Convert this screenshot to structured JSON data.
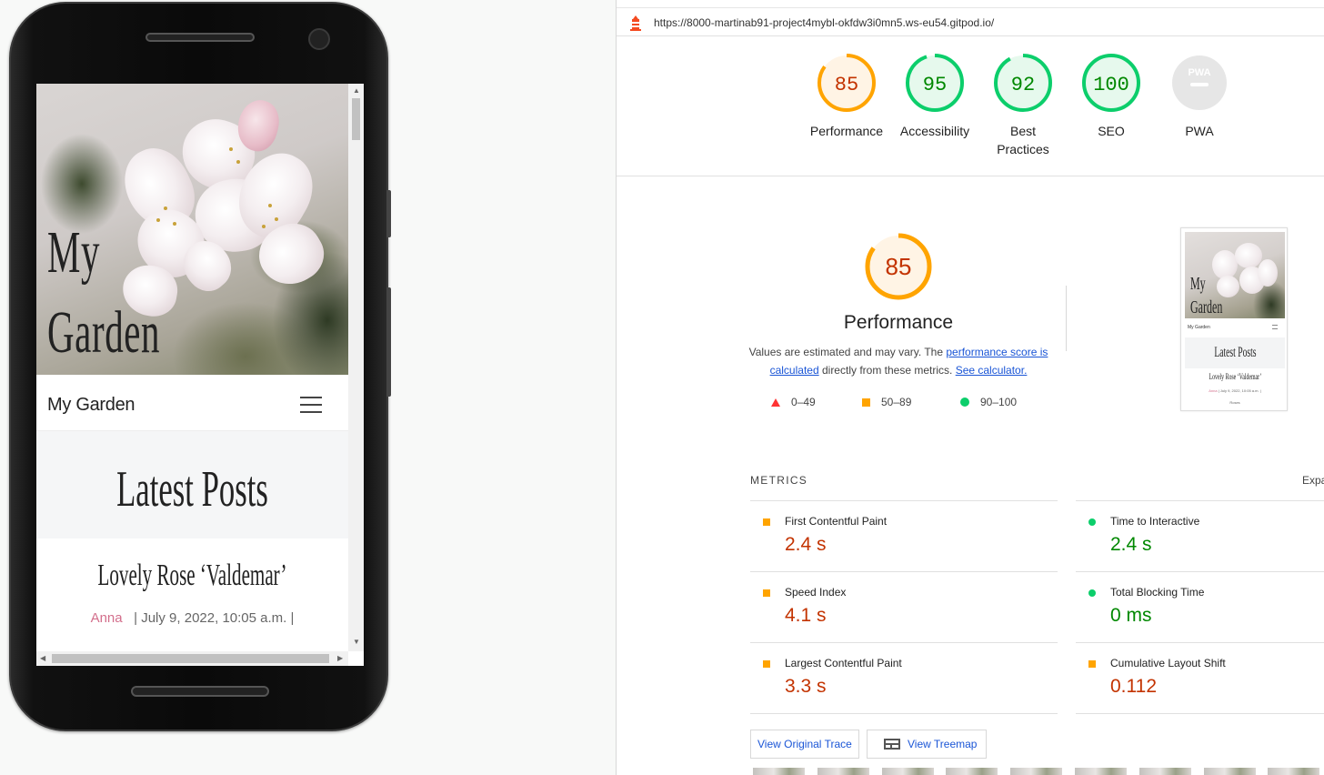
{
  "device": {
    "hero_title_line1": "My",
    "hero_title_line2": "Garden",
    "brand": "My Garden",
    "latest_posts": "Latest Posts",
    "post": {
      "title": "Lovely Rose ‘Valdemar’",
      "author": "Anna",
      "sep1": "|",
      "date": "July 9, 2022, 10:05 a.m.",
      "sep2": "|"
    }
  },
  "report": {
    "url": "https://8000-martinab91-project4mybl-okfdw3i0mn5.ws-eu54.gitpod.io/",
    "gauges": [
      {
        "label": "Performance",
        "score": "85",
        "status": "average"
      },
      {
        "label": "Accessibility",
        "score": "95",
        "status": "pass"
      },
      {
        "label": "Best Practices",
        "score": "92",
        "status": "pass"
      },
      {
        "label": "SEO",
        "score": "100",
        "status": "pass"
      },
      {
        "label": "PWA",
        "score": "PWA",
        "status": "na"
      }
    ],
    "performance": {
      "score": "85",
      "title": "Performance",
      "desc_text1": "Values are estimated and may vary. The ",
      "desc_link1": "performance score is calculated",
      "desc_text2": " directly from these metrics. ",
      "desc_link2": "See calculator."
    },
    "legend": [
      {
        "range": "0–49",
        "shape": "triangle",
        "color": "#ff3333"
      },
      {
        "range": "50–89",
        "shape": "square",
        "color": "#ffa400"
      },
      {
        "range": "90–100",
        "shape": "circle",
        "color": "#0cce6b"
      }
    ],
    "thumbnail": {
      "hero_line1": "My",
      "hero_line2": "Garden",
      "brand": "My Garden",
      "latest": "Latest Posts",
      "post_title": "Lovely Rose ‘Valdemar’",
      "author": "Anna",
      "meta": "| July 9, 2022, 10:05 a.m. |",
      "more": "Roses"
    },
    "metrics_heading": "METRICS",
    "expand_label": "Expa",
    "metrics": [
      {
        "name": "First Contentful Paint",
        "value": "2.4 s",
        "status": "average"
      },
      {
        "name": "Time to Interactive",
        "value": "2.4 s",
        "status": "pass"
      },
      {
        "name": "Speed Index",
        "value": "4.1 s",
        "status": "average"
      },
      {
        "name": "Total Blocking Time",
        "value": "0 ms",
        "status": "pass"
      },
      {
        "name": "Largest Contentful Paint",
        "value": "3.3 s",
        "status": "average"
      },
      {
        "name": "Cumulative Layout Shift",
        "value": "0.112",
        "status": "average"
      }
    ],
    "buttons": {
      "view_trace": "View Original Trace",
      "view_treemap": "View Treemap"
    },
    "colors": {
      "pass": "#0cce6b",
      "pass_text": "#008800",
      "average": "#ffa400",
      "average_text": "#c33300",
      "fail": "#ff3333",
      "na": "#9e9e9e",
      "link": "#1a55d6"
    }
  }
}
